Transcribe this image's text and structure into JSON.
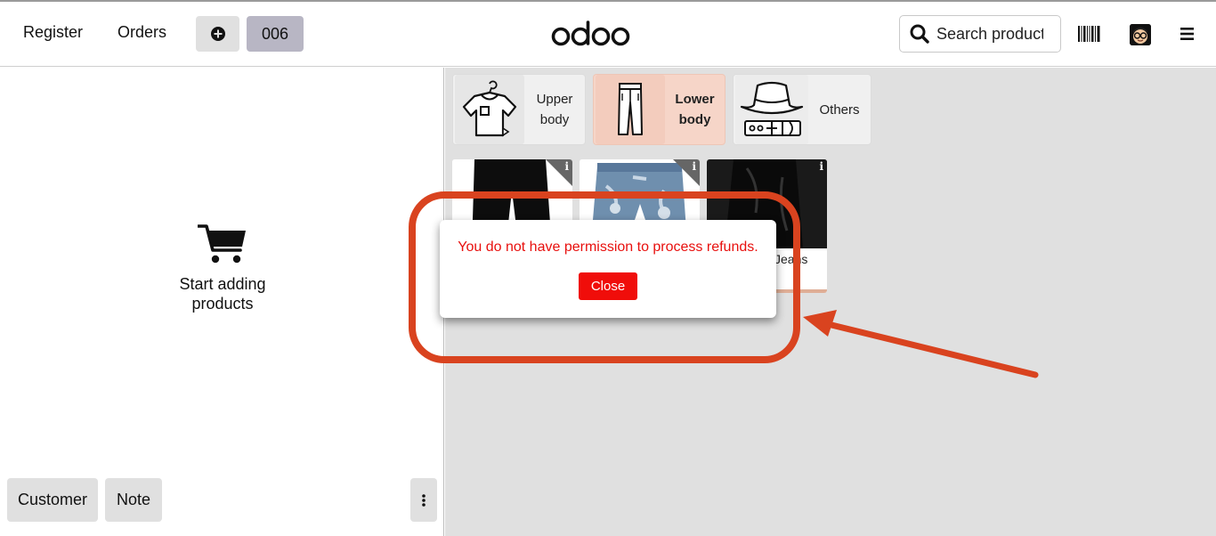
{
  "header": {
    "register_label": "Register",
    "orders_label": "Orders",
    "order_number": "006",
    "logo_text": "odoo",
    "search": {
      "placeholder": "Search products"
    }
  },
  "categories": [
    {
      "label_line1": "Upper",
      "label_line2": "body",
      "icon": "tshirt-icon"
    },
    {
      "label_line1": "Lower",
      "label_line2": "body",
      "icon": "trousers-icon",
      "selected": true
    },
    {
      "label": "Others",
      "icon": "hat-belt-icon"
    }
  ],
  "products": [
    {
      "name": "",
      "image": "black-trousers"
    },
    {
      "name": "",
      "image": "denim-shorts"
    },
    {
      "name": "Jeans",
      "image": "black-jeans"
    }
  ],
  "order_panel": {
    "empty_line1": "Start adding",
    "empty_line2": "products",
    "customer_label": "Customer",
    "note_label": "Note"
  },
  "dialog": {
    "message": "You do not have permission to process refunds.",
    "close_label": "Close"
  },
  "colors": {
    "selected_category": "#f6d5c8",
    "error_text": "#e8100e",
    "close_button": "#f00d0a",
    "annotation": "#d9431f"
  }
}
